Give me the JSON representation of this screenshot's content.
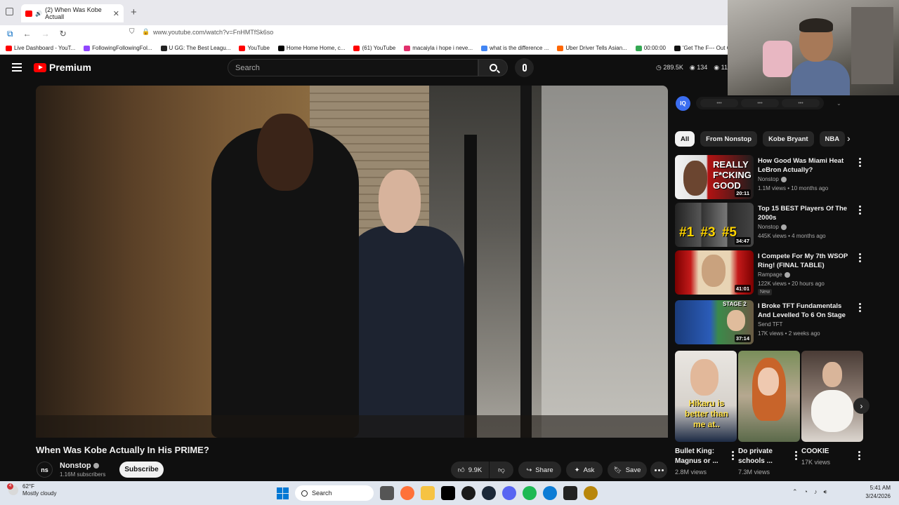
{
  "browser": {
    "tab_title": "(2) When Was Kobe Actuall",
    "tab_close": "✕",
    "new_tab": "+",
    "url": "www.youtube.com/watch?v=FnHMTfSk6so",
    "bookmarks": [
      {
        "label": "Live Dashboard - YouT...",
        "color": "#ff0000"
      },
      {
        "label": "FollowingFollowingFol...",
        "color": "#9146ff"
      },
      {
        "label": "U GG: The Best Leagu...",
        "color": "#222222"
      },
      {
        "label": "YouTube",
        "color": "#ff0000"
      },
      {
        "label": "Home Home Home, c...",
        "color": "#000000"
      },
      {
        "label": "(61) YouTube",
        "color": "#ff0000"
      },
      {
        "label": "macaiyla i hope i neve...",
        "color": "#e1306c"
      },
      {
        "label": "what is the difference ...",
        "color": "#4285f4"
      },
      {
        "label": "Uber Driver Tells Asian...",
        "color": "#ff6600"
      },
      {
        "label": "00:00:00",
        "color": "#34a853"
      },
      {
        "label": "'Get The F--- Out Of M",
        "color": "#111111"
      }
    ]
  },
  "header": {
    "logo_text": "Premium",
    "search_placeholder": "Search",
    "stats": [
      "289.5K",
      "134",
      "11.9"
    ]
  },
  "video": {
    "title": "When Was Kobe Actually In His PRIME?",
    "channel": "Nonstop",
    "channel_initials": "ns",
    "subscribers": "1.16M subscribers",
    "subscribe_label": "Subscribe",
    "actions": {
      "likes": "9.9K",
      "share": "Share",
      "ask": "Ask",
      "save": "Save"
    }
  },
  "iq": {
    "logo": "IQ",
    "pills": [
      "•••",
      "•••",
      "•••"
    ]
  },
  "chips": [
    "All",
    "From Nonstop",
    "Kobe Bryant",
    "NBA"
  ],
  "recommendations": [
    {
      "title": "How Good Was Miami Heat LeBron Actually?",
      "channel": "Nonstop",
      "meta": "1.1M views • 10 months ago",
      "duration": "20:11",
      "thumb_text": "REALLY F*CKING GOOD",
      "new": ""
    },
    {
      "title": "Top 15 BEST Players Of The 2000s",
      "channel": "Nonstop",
      "meta": "445K views • 4 months ago",
      "duration": "34:47",
      "thumb_text": "#1 #3 #5",
      "new": ""
    },
    {
      "title": "I Compete For My 7th WSOP Ring! (FINAL TABLE)",
      "channel": "Rampage",
      "meta": "122K views • 20 hours ago",
      "duration": "41:01",
      "thumb_text": "",
      "new": "New"
    },
    {
      "title": "I Broke TFT Fundamentals And Levelled To 6 On Stage 2... An...",
      "channel": "Send TFT",
      "meta": "17K views • 2 weeks ago",
      "duration": "37:14",
      "thumb_text": "STAGE 2",
      "new": ""
    }
  ],
  "shorts": [
    {
      "title": "Bullet King: Magnus or ...",
      "views": "2.8M views",
      "thumb_text": "Hikaru is better than me at.."
    },
    {
      "title": "Do private schools ...",
      "views": "7.3M views",
      "thumb_text": ""
    },
    {
      "title": "COOKIE",
      "views": "17K views",
      "thumb_text": ""
    }
  ],
  "taskbar": {
    "temp": "62°F",
    "weather": "Mostly cloudy",
    "badge": "4",
    "search": "Search",
    "time": "5:41 AM",
    "date": "3/24/2026"
  }
}
